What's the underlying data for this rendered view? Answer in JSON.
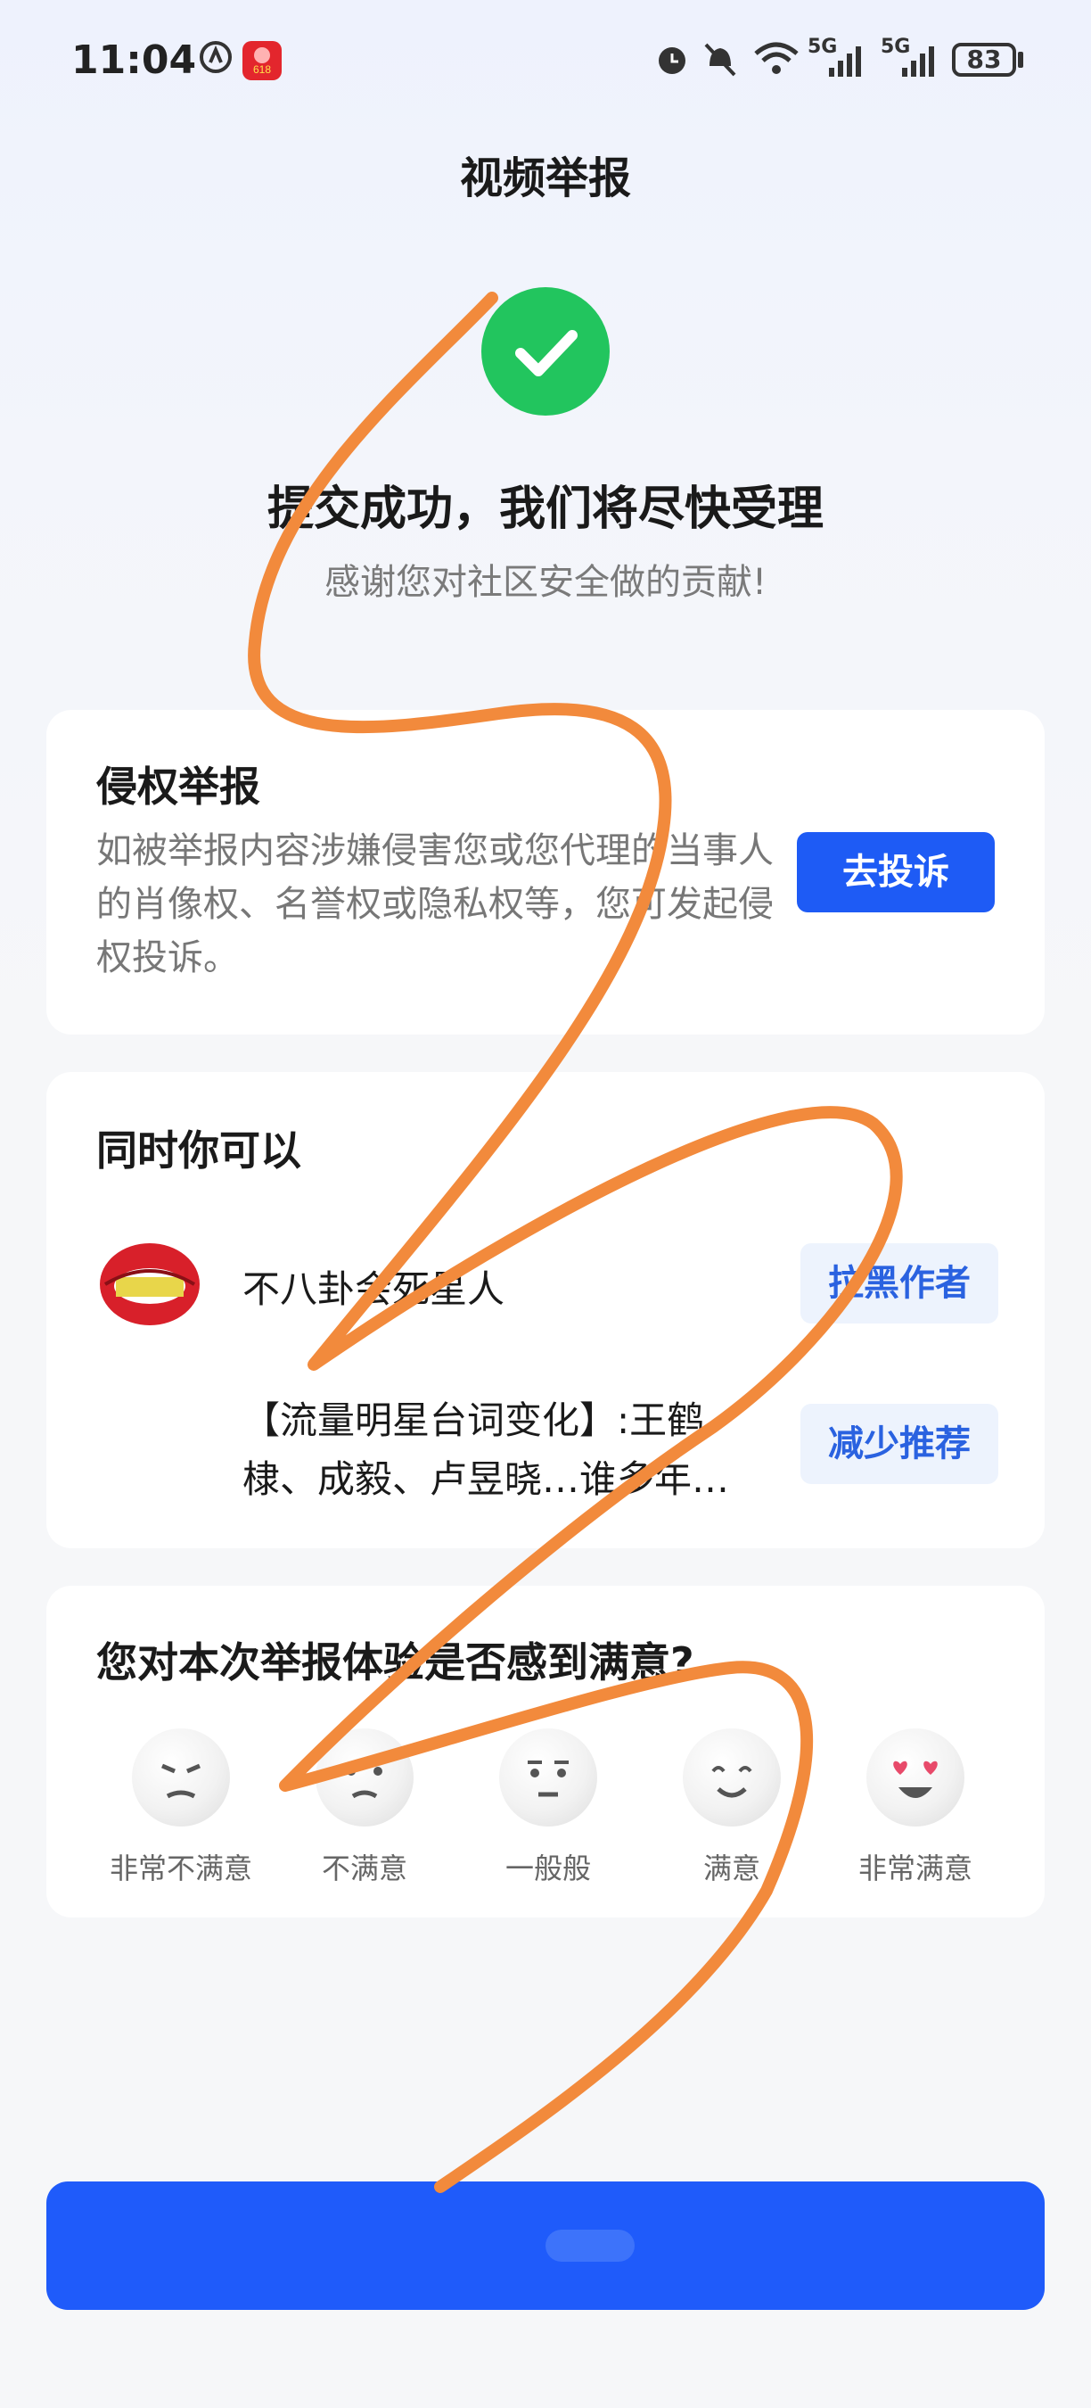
{
  "status": {
    "time": "11:04",
    "battery": "83",
    "network": "5G"
  },
  "header": {
    "title": "视频举报"
  },
  "result": {
    "headline": "提交成功，我们将尽快受理",
    "subline": "感谢您对社区安全做的贡献!"
  },
  "rights_card": {
    "title": "侵权举报",
    "description": "如被举报内容涉嫌侵害您或您代理的当事人的肖像权、名誉权或隐私权等，您可发起侵权投诉。",
    "button": "去投诉"
  },
  "also_card": {
    "title": "同时你可以",
    "author_name": "不八卦会死星人",
    "block_button": "拉黑作者",
    "video_title": "【流量明星台词变化】:王鹤棣、成毅、卢昱晓…谁多年…",
    "reduce_button": "减少推荐"
  },
  "survey": {
    "question": "您对本次举报体验是否感到满意?",
    "options": [
      {
        "label": "非常不满意",
        "icon": "angry-face-icon"
      },
      {
        "label": "不满意",
        "icon": "frown-face-icon"
      },
      {
        "label": "一般般",
        "icon": "neutral-face-icon"
      },
      {
        "label": "满意",
        "icon": "smile-face-icon"
      },
      {
        "label": "非常满意",
        "icon": "heart-eyes-face-icon"
      }
    ]
  },
  "colors": {
    "primary": "#1e5bf5",
    "success": "#22c55e",
    "scribble": "#f28a3c"
  }
}
